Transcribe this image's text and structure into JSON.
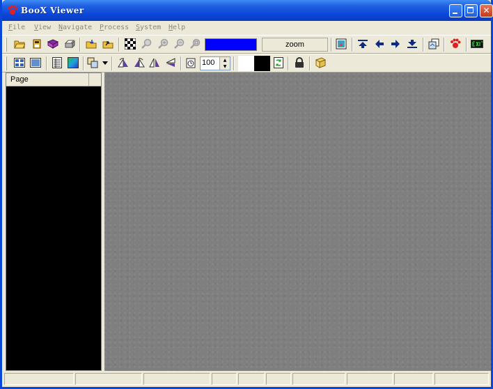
{
  "window": {
    "title": "BooX Viewer",
    "buttons": {
      "minimize": "minimize-icon",
      "maximize": "maximize-icon",
      "close": "close-icon"
    }
  },
  "menu": [
    "File",
    "View",
    "Navigate",
    "Process",
    "System",
    "Help"
  ],
  "toolbar1": {
    "color_swatch": "#0000ff",
    "zoom_label": "zoom"
  },
  "toolbar2": {
    "rotation_value": "100",
    "foreground_color": "#ffffff",
    "background_color": "#000000"
  },
  "left_panel": {
    "header": "Page"
  },
  "status_bar": {
    "panes": [
      "",
      "",
      "",
      "",
      "",
      "",
      "",
      "",
      "",
      ""
    ]
  },
  "colors": {
    "title_blue": "#0a46d8",
    "canvas_gray": "#7f7f7f",
    "panel_black": "#000000",
    "chrome": "#ece9d8"
  }
}
